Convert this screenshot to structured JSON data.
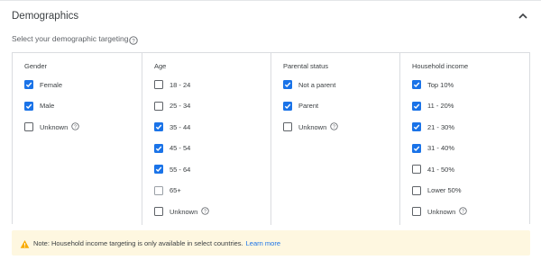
{
  "section": {
    "title": "Demographics",
    "subtitle": "Select your demographic targeting"
  },
  "columns": [
    {
      "header": "Gender",
      "options": [
        {
          "label": "Female",
          "checked": true,
          "help": false
        },
        {
          "label": "Male",
          "checked": true,
          "help": false
        },
        {
          "label": "Unknown",
          "checked": false,
          "help": true
        }
      ]
    },
    {
      "header": "Age",
      "options": [
        {
          "label": "18 - 24",
          "checked": false,
          "help": false
        },
        {
          "label": "25 - 34",
          "checked": false,
          "help": false
        },
        {
          "label": "35 - 44",
          "checked": true,
          "help": false
        },
        {
          "label": "45 - 54",
          "checked": true,
          "help": false
        },
        {
          "label": "55 - 64",
          "checked": true,
          "help": false
        },
        {
          "label": "65+",
          "checked": false,
          "help": false
        },
        {
          "label": "Unknown",
          "checked": false,
          "help": true
        }
      ]
    },
    {
      "header": "Parental status",
      "options": [
        {
          "label": "Not a parent",
          "checked": true,
          "help": false
        },
        {
          "label": "Parent",
          "checked": true,
          "help": false
        },
        {
          "label": "Unknown",
          "checked": false,
          "help": true
        }
      ]
    },
    {
      "header": "Household income",
      "options": [
        {
          "label": "Top 10%",
          "checked": true,
          "help": false
        },
        {
          "label": "11 - 20%",
          "checked": true,
          "help": false
        },
        {
          "label": "21 - 30%",
          "checked": true,
          "help": false
        },
        {
          "label": "31 - 40%",
          "checked": true,
          "help": false
        },
        {
          "label": "41 - 50%",
          "checked": false,
          "help": false
        },
        {
          "label": "Lower 50%",
          "checked": false,
          "help": false
        },
        {
          "label": "Unknown",
          "checked": false,
          "help": true
        }
      ]
    }
  ],
  "notice": {
    "text": "Note: Household income targeting is only available in select countries.",
    "link": "Learn more"
  },
  "colors": {
    "accent": "#1a73e8",
    "warning": "#f9ab00",
    "notice_bg": "#fef7e0",
    "border": "#dadce0"
  },
  "icons": {
    "collapse": "chevron-up-icon",
    "help": "help-circle-icon",
    "warning": "warning-icon",
    "check": "checkmark-icon"
  }
}
